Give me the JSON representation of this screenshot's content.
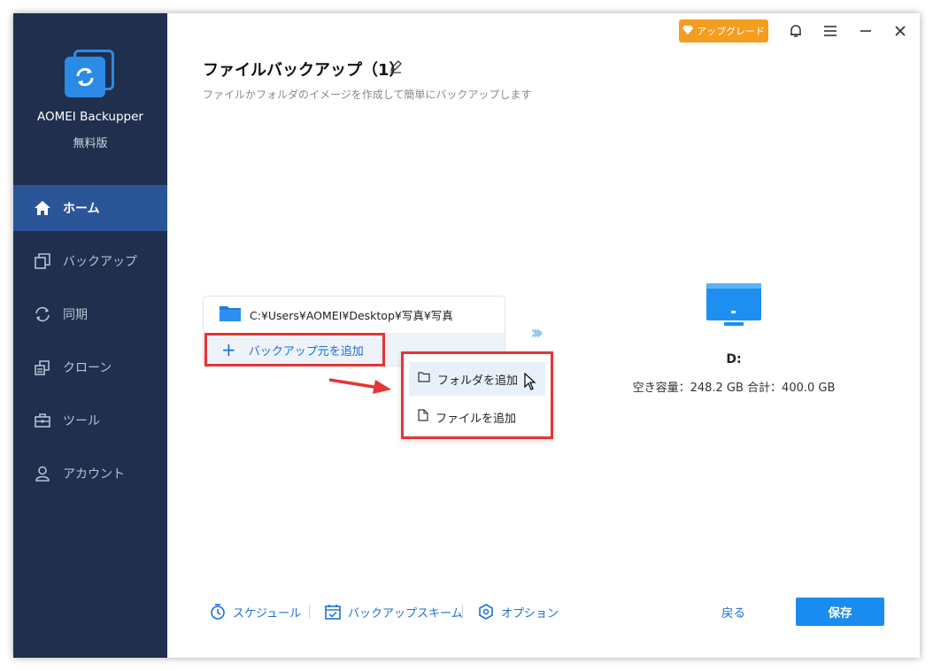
{
  "sidebar": {
    "app_name": "AOMEI Backupper",
    "edition": "無料版",
    "items": [
      {
        "label": "ホーム",
        "icon": "home-icon",
        "active": true
      },
      {
        "label": "バックアップ",
        "icon": "backup-icon",
        "active": false
      },
      {
        "label": "同期",
        "icon": "sync-icon",
        "active": false
      },
      {
        "label": "クローン",
        "icon": "clone-icon",
        "active": false
      },
      {
        "label": "ツール",
        "icon": "tools-icon",
        "active": false
      },
      {
        "label": "アカウント",
        "icon": "account-icon",
        "active": false
      }
    ]
  },
  "topbar": {
    "upgrade_label": "アップグレード"
  },
  "header": {
    "title": "ファイルバックアップ（1）",
    "subtitle": "ファイルかフォルダのイメージを作成して簡単にバックアップします"
  },
  "source": {
    "path": "C:¥Users¥AOMEI¥Desktop¥写真¥写真",
    "add_label": "バックアップ元を追加",
    "menu": {
      "add_folder": "フォルダを追加",
      "add_file": "ファイルを追加"
    }
  },
  "destination": {
    "drive": "D:",
    "space": "空き容量：248.2 GB 合計：400.0 GB"
  },
  "footer": {
    "schedule": "スケジュール",
    "scheme": "バックアップスキーム",
    "options": "オプション",
    "back": "戻る",
    "save": "保存"
  },
  "colors": {
    "sidebar_bg": "#1f2f4d",
    "sidebar_active": "#2a5698",
    "accent": "#1a8cf0",
    "upgrade": "#f49d1f",
    "highlight_border": "#e53535"
  }
}
